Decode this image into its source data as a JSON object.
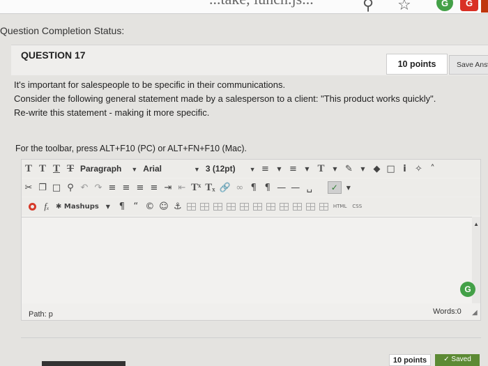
{
  "browser": {
    "tab_title_fragment": "...take, lunch.js...",
    "icons": [
      "search-icon",
      "star-icon",
      "extension-green-icon",
      "extension-red-icon"
    ]
  },
  "question_completion_status": "Question Completion Status:",
  "question": {
    "title": "QUESTION 17",
    "points": "10 points",
    "save_label": "Save Answer",
    "prompt_lines": [
      "It's important for salespeople to be specific in their communications.",
      "Consider the following general statement made by a salesperson to a client: \"This product works quickly\".",
      "Re-write this statement - making it more specific."
    ]
  },
  "editor": {
    "toolbar_hint": "For the toolbar, press ALT+F10 (PC) or ALT+FN+F10 (Mac).",
    "format_select": "Paragraph",
    "font_select": "Arial",
    "size_select": "3 (12pt)",
    "mashups_label": "Mashups",
    "html_label": "HTML",
    "css_label": "CSS",
    "path_label": "Path: p",
    "word_count": "Words:0"
  },
  "footer": {
    "points": "10 points",
    "saved_label": "Saved"
  },
  "colors": {
    "background": "#e4e3e0",
    "header_bg": "#efeeec",
    "saved_green": "#5c8a34",
    "badge_green": "#43a047"
  }
}
